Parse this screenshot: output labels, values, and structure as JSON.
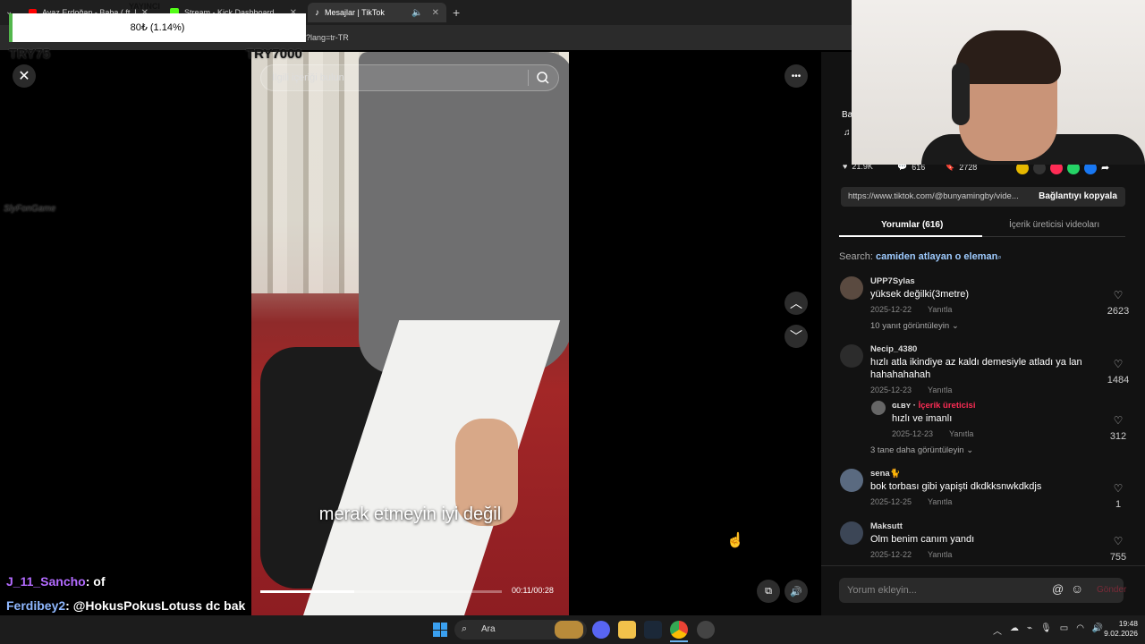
{
  "browser": {
    "tabs": [
      {
        "label": "Ayaz Erdoğan - Baba ( ft. Men...",
        "active": false
      },
      {
        "label": "Stream - Kick Dashboard",
        "active": false
      },
      {
        "label": "Mesajlar | TikTok",
        "active": true
      }
    ],
    "new_tab": "+",
    "url": "?lang=tr-TR",
    "behind_text": "YAYINCI",
    "close_glyph": "✕"
  },
  "overlay": {
    "donation_text": "80₺ (1.14%)",
    "donation_progress": 0.0114,
    "left_label": "TRY75",
    "center_label": "TRY7000",
    "side_logo": "SlyFonGame"
  },
  "tiktok": {
    "close_glyph": "✕",
    "search_placeholder": "İlgili içeriği bulun",
    "more_glyph": "•••",
    "caption": "merak etmeyin iyi değil",
    "time": "00:11/00:28",
    "progress": 0.39,
    "nav_up": "︿",
    "nav_down": "﹀",
    "video_side_text": "Ba",
    "music_note": "♫",
    "stats": {
      "likes": "21.9K",
      "comments": "616",
      "saves": "2728"
    },
    "link": "https://www.tiktok.com/@bunyamingby/vide...",
    "copy_label": "Bağlantıyı kopyala",
    "tabs": {
      "comments": "Yorumlar (616)",
      "creator": "İçerik üreticisi videoları"
    },
    "search_hint_prefix": "Search:",
    "search_hint_query": "camiden atlayan o eleman",
    "comments": [
      {
        "user": "UPP7Sylas",
        "text": "yüksek değilki(3metre)",
        "date": "2025-12-22",
        "reply": "Yanıtla",
        "likes": "2623",
        "more": "10 yanıt görüntüleyin"
      },
      {
        "user": "Necip_4380",
        "text": "hızlı atla ikindiye az kaldı demesiyle atladı ya lan hahahahahah",
        "date": "2025-12-23",
        "reply": "Yanıtla",
        "likes": "1484"
      },
      {
        "user": "sena🐈",
        "text": "bok torbası gibi yapişti dkdkksnwkdkdjs",
        "date": "2025-12-25",
        "reply": "Yanıtla",
        "likes": "1"
      },
      {
        "user": "Maksutt",
        "text": "Olm benim canım yandı",
        "date": "2025-12-22",
        "reply": "Yanıtla",
        "likes": "755"
      }
    ],
    "creator_reply": {
      "user": "ɢʟʙʏ",
      "badge": "İçerik üreticisi",
      "text": "hızlı ve imanlı",
      "date": "2025-12-23",
      "reply": "Yanıtla",
      "likes": "312",
      "more": "3 tane daha görüntüleyin"
    },
    "comment_placeholder": "Yorum ekleyin...",
    "send_label": "Gönder",
    "at_glyph": "@",
    "emoji_glyph": "☺"
  },
  "chat": [
    {
      "user": "J_11_Sancho",
      "message": ": of",
      "color": "#b36bff"
    },
    {
      "user": "Ferdibey2",
      "message": ": @HokusPokusLotuss dc bak",
      "color": "#8fb8ff"
    }
  ],
  "taskbar": {
    "search": "Ara",
    "time": "19:48",
    "date": "9.02.2026"
  },
  "colors": {
    "accent": "#fe2c55",
    "donation_bar": "#53b74c"
  }
}
